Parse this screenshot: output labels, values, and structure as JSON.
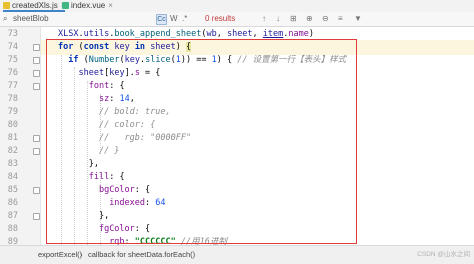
{
  "tabs": [
    {
      "label": "createdXls.js",
      "color": "#e7c12e",
      "active": true
    },
    {
      "label": "index.vue",
      "color": "#41b883",
      "active": false
    }
  ],
  "find": {
    "query": "sheetBlob",
    "results": "0 results",
    "case_toggle": "Cc",
    "word_toggle": "W",
    "regex_toggle": ".*"
  },
  "editor": {
    "line_numbers": [
      "73",
      "74",
      "75",
      "76",
      "77",
      "78",
      "79",
      "80",
      "81",
      "82",
      "83",
      "84",
      "85",
      "86",
      "87",
      "88",
      "89"
    ]
  },
  "breadcrumb": {
    "item1": "exportExcel()",
    "separator": "›",
    "item2": "callback for sheetData.forEach()"
  },
  "watermark": "CSDN @山水之间"
}
